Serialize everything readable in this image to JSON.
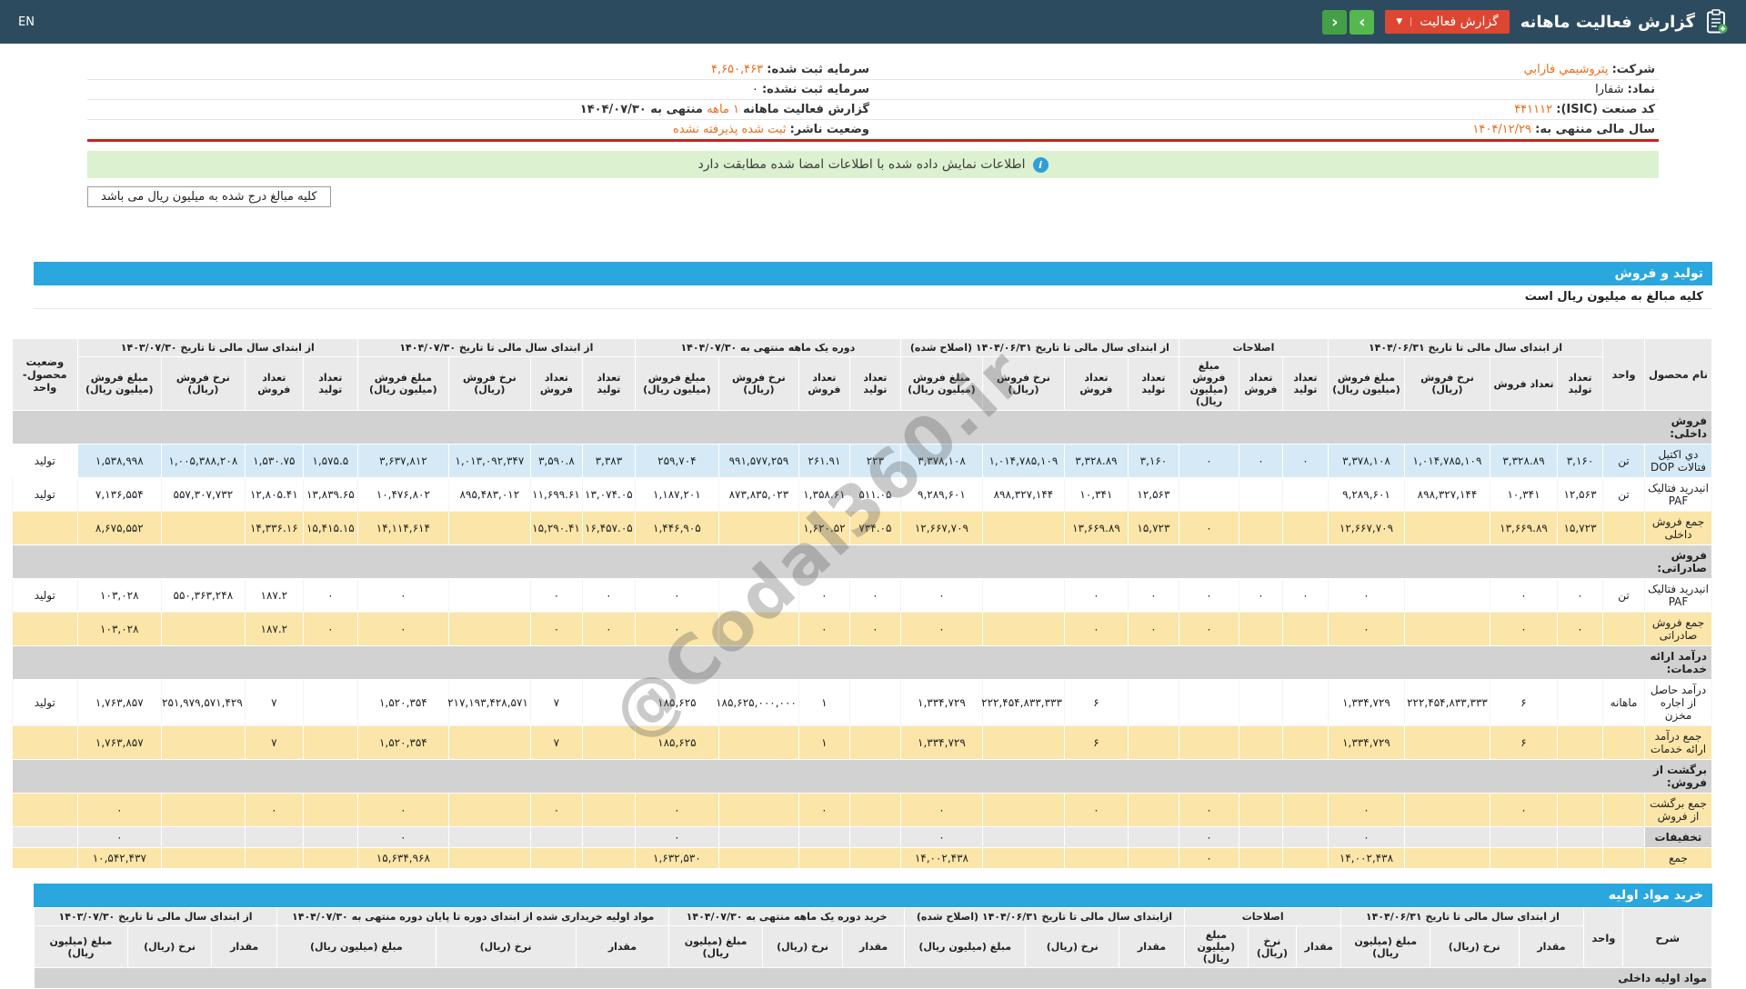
{
  "topbar": {
    "en_label": "EN",
    "title": "گزارش فعالیت ماهانه",
    "report_button_label": "گزارش فعالیت",
    "caret": "▼",
    "nav_right_icon": "›",
    "nav_left_icon": "‹"
  },
  "company_info": {
    "rows": [
      {
        "right_label": "شرکت:",
        "right_value": "پتروشيمي فارابي",
        "right_orange": true,
        "left_label": "سرمایه ثبت شده:",
        "left_value": "۴,۶۵۰,۴۶۳",
        "left_orange": true
      },
      {
        "right_label": "نماد:",
        "right_value": "شفارا",
        "right_orange": false,
        "left_label": "سرمایه ثبت نشده:",
        "left_value": "۰",
        "left_orange": false
      },
      {
        "right_label": "کد صنعت (ISIC):",
        "right_value": "۴۴۱۱۱۲",
        "right_orange": true,
        "left_label": "گزارش فعالیت ماهانه",
        "left_value": "۱ ماهه",
        "left_orange": true,
        "left_suffix": "منتهی به ۱۴۰۴/۰۷/۳۰"
      },
      {
        "right_label": "سال مالی منتهی به:",
        "right_value": "۱۴۰۴/۱۲/۲۹",
        "right_orange": true,
        "left_label": "وضعیت ناشر:",
        "left_value": "ثبت شده پذیرفته نشده",
        "left_orange": true
      }
    ]
  },
  "notice": {
    "icon": "i",
    "text": "اطلاعات نمایش داده شده با اطلاعات امضا شده مطابقت دارد"
  },
  "amounts_note": "کلیه مبالغ درج شده به میلیون ریال می باشد",
  "watermark": "@Codal360.ir",
  "sales_table": {
    "section_title": "تولید و فروش",
    "subtitle": "کلیه مبالغ به میلیون ریال است",
    "col_name": "نام محصول",
    "col_unit": "واحد",
    "corner": "وضعیت محصول- واحد",
    "groups": [
      {
        "title": "از ابتدای سال مالی تا تاریخ ۱۴۰۴/۰۶/۳۱",
        "cols": [
          "تعداد تولید",
          "تعداد فروش",
          "نرخ فروش (ریال)",
          "مبلغ فروش (میلیون ریال)"
        ]
      },
      {
        "title": "اصلاحات",
        "cols": [
          "تعداد تولید",
          "تعداد فروش",
          "مبلغ فروش (میلیون ریال)"
        ]
      },
      {
        "title": "از ابتدای سال مالی تا تاریخ ۱۴۰۴/۰۶/۳۱ (اصلاح شده)",
        "cols": [
          "تعداد تولید",
          "تعداد فروش",
          "نرخ فروش (ریال)",
          "مبلغ فروش (میلیون ریال)"
        ]
      },
      {
        "title": "دوره یک ماهه منتهی به ۱۴۰۴/۰۷/۳۰",
        "cols": [
          "تعداد تولید",
          "تعداد فروش",
          "نرخ فروش (ریال)",
          "مبلغ فروش (میلیون ریال)"
        ]
      },
      {
        "title": "از ابتدای سال مالی تا تاریخ ۱۴۰۴/۰۷/۳۰",
        "cols": [
          "تعداد تولید",
          "تعداد فروش",
          "نرخ فروش (ریال)",
          "مبلغ فروش (میلیون ریال)"
        ]
      },
      {
        "title": "از ابتدای سال مالی تا تاریخ ۱۴۰۳/۰۷/۳۰",
        "cols": [
          "تعداد تولید",
          "تعداد فروش",
          "نرخ فروش (ریال)",
          "مبلغ فروش (میلیون ریال)"
        ]
      }
    ],
    "rows": [
      {
        "type": "section",
        "label": "فروش داخلی:"
      },
      {
        "type": "data",
        "style": "blue",
        "name": "دي اکتيل فتالات DOP",
        "unit": "تن",
        "status": "تولید",
        "cells": [
          "۳,۱۶۰",
          "۳,۳۲۸.۸۹",
          "۱,۰۱۴,۷۸۵,۱۰۹",
          "۳,۳۷۸,۱۰۸",
          "۰",
          "۰",
          "۰",
          "۳,۱۶۰",
          "۳,۳۲۸.۸۹",
          "۱,۰۱۴,۷۸۵,۱۰۹",
          "۳,۳۷۸,۱۰۸",
          "۲۲۳",
          "۲۶۱.۹۱",
          "۹۹۱,۵۷۷,۲۵۹",
          "۲۵۹,۷۰۴",
          "۳,۳۸۳",
          "۳,۵۹۰.۸",
          "۱,۰۱۳,۰۹۲,۳۴۷",
          "۳,۶۳۷,۸۱۲",
          "۱,۵۷۵.۵",
          "۱,۵۳۰.۷۵",
          "۱,۰۰۵,۳۸۸,۲۰۸",
          "۱,۵۳۸,۹۹۸"
        ]
      },
      {
        "type": "data",
        "style": "white",
        "name": "انیدرید فتالیک PAF",
        "unit": "تن",
        "status": "تولید",
        "cells": [
          "۱۲,۵۶۳",
          "۱۰,۳۴۱",
          "۸۹۸,۳۲۷,۱۴۴",
          "۹,۲۸۹,۶۰۱",
          "",
          "",
          "",
          "۱۲,۵۶۳",
          "۱۰,۳۴۱",
          "۸۹۸,۳۲۷,۱۴۴",
          "۹,۲۸۹,۶۰۱",
          "۵۱۱.۰۵",
          "۱,۳۵۸.۶۱",
          "۸۷۳,۸۳۵,۰۲۳",
          "۱,۱۸۷,۲۰۱",
          "۱۳,۰۷۴.۰۵",
          "۱۱,۶۹۹.۶۱",
          "۸۹۵,۴۸۳,۰۱۲",
          "۱۰,۴۷۶,۸۰۲",
          "۱۳,۸۳۹.۶۵",
          "۱۲,۸۰۵.۴۱",
          "۵۵۷,۳۰۷,۷۳۲",
          "۷,۱۳۶,۵۵۴"
        ]
      },
      {
        "type": "data",
        "style": "orange",
        "name": "جمع فروش داخلی",
        "unit": "",
        "status": "",
        "cells": [
          "۱۵,۷۲۳",
          "۱۳,۶۶۹.۸۹",
          "",
          "۱۲,۶۶۷,۷۰۹",
          "",
          "",
          "۰",
          "۱۵,۷۲۳",
          "۱۳,۶۶۹.۸۹",
          "",
          "۱۲,۶۶۷,۷۰۹",
          "۷۳۴.۰۵",
          "۱,۶۲۰.۵۲",
          "",
          "۱,۴۴۶,۹۰۵",
          "۱۶,۴۵۷.۰۵",
          "۱۵,۲۹۰.۴۱",
          "",
          "۱۴,۱۱۴,۶۱۴",
          "۱۵,۴۱۵.۱۵",
          "۱۴,۳۳۶.۱۶",
          "",
          "۸,۶۷۵,۵۵۲"
        ]
      },
      {
        "type": "section",
        "label": "فروش صادراتی:"
      },
      {
        "type": "data",
        "style": "white",
        "name": "انیدرید فتالیک PAF",
        "unit": "تن",
        "status": "تولید",
        "cells": [
          "۰",
          "۰",
          "",
          "۰",
          "۰",
          "۰",
          "۰",
          "۰",
          "۰",
          "",
          "۰",
          "۰",
          "۰",
          "",
          "۰",
          "۰",
          "۰",
          "",
          "۰",
          "۰",
          "۱۸۷.۲",
          "۵۵۰,۳۶۳,۲۴۸",
          "۱۰۳,۰۲۸"
        ]
      },
      {
        "type": "data",
        "style": "orange",
        "name": "جمع فروش صادراتی",
        "unit": "",
        "status": "",
        "cells": [
          "۰",
          "۰",
          "",
          "۰",
          "",
          "",
          "۰",
          "۰",
          "۰",
          "",
          "۰",
          "۰",
          "۰",
          "",
          "۰",
          "۰",
          "۰",
          "",
          "۰",
          "۰",
          "۱۸۷.۲",
          "",
          "۱۰۳,۰۲۸"
        ]
      },
      {
        "type": "section",
        "label": "درآمد ارائه خدمات:"
      },
      {
        "type": "data",
        "style": "white",
        "name": "درآمد حاصل از اجاره مخزن",
        "unit": "ماهانه",
        "status": "تولید",
        "cells": [
          "",
          "۶",
          "۲۲۲,۴۵۴,۸۳۳,۳۳۳",
          "۱,۳۳۴,۷۲۹",
          "",
          "",
          "",
          "",
          "۶",
          "۲۲۲,۴۵۴,۸۳۳,۳۳۳",
          "۱,۳۳۴,۷۲۹",
          "",
          "۱",
          "۱۸۵,۶۲۵,۰۰۰,۰۰۰",
          "۱۸۵,۶۲۵",
          "",
          "۷",
          "۲۱۷,۱۹۳,۴۲۸,۵۷۱",
          "۱,۵۲۰,۳۵۴",
          "",
          "۷",
          "۲۵۱,۹۷۹,۵۷۱,۴۲۹",
          "۱,۷۶۳,۸۵۷"
        ]
      },
      {
        "type": "data",
        "style": "orange",
        "name": "جمع درآمد ارائه خدمات",
        "unit": "",
        "status": "",
        "cells": [
          "",
          "۶",
          "",
          "۱,۳۳۴,۷۲۹",
          "",
          "",
          "",
          "",
          "۶",
          "",
          "۱,۳۳۴,۷۲۹",
          "",
          "۱",
          "",
          "۱۸۵,۶۲۵",
          "",
          "۷",
          "",
          "۱,۵۲۰,۳۵۴",
          "",
          "۷",
          "",
          "۱,۷۶۳,۸۵۷"
        ]
      },
      {
        "type": "section",
        "label": "برگشت از فروش:"
      },
      {
        "type": "data",
        "style": "orange",
        "name": "جمع برگشت از فروش",
        "unit": "",
        "status": "",
        "cells": [
          "",
          "۰",
          "",
          "۰",
          "",
          "",
          "۰",
          "",
          "۰",
          "",
          "۰",
          "",
          "۰",
          "",
          "۰",
          "",
          "۰",
          "",
          "۰",
          "",
          "۰",
          "",
          "۰"
        ]
      },
      {
        "type": "data",
        "style": "gray",
        "name": "تخفیفات",
        "unit": "",
        "status": "",
        "cells": [
          "",
          "",
          "",
          "۰",
          "",
          "",
          "۰",
          "",
          "",
          "",
          "۰",
          "",
          "",
          "",
          "۰",
          "",
          "",
          "",
          "۰",
          "",
          "",
          "",
          "۰"
        ]
      },
      {
        "type": "data",
        "style": "orange",
        "name": "جمع",
        "unit": "",
        "status": "",
        "cells": [
          "",
          "",
          "",
          "۱۴,۰۰۲,۴۳۸",
          "",
          "",
          "۰",
          "",
          "",
          "",
          "۱۴,۰۰۲,۴۳۸",
          "",
          "",
          "",
          "۱,۶۳۲,۵۳۰",
          "",
          "",
          "",
          "۱۵,۶۳۴,۹۶۸",
          "",
          "",
          "",
          "۱۰,۵۴۲,۴۳۷"
        ]
      }
    ]
  },
  "materials_table": {
    "section_title": "خرید مواد اولیه",
    "col_name": "شرح",
    "col_unit": "واحد",
    "groups": [
      {
        "title": "از ابتدای سال مالی تا تاریخ ۱۴۰۴/۰۶/۳۱",
        "cols": [
          "مقدار",
          "نرخ (ریال)",
          "مبلغ (میلیون ریال)"
        ]
      },
      {
        "title": "اصلاحات",
        "cols": [
          "مقدار",
          "نرخ (ریال)",
          "مبلغ (میلیون ریال)"
        ]
      },
      {
        "title": "ازابتدای سال مالی تا تاریخ ۱۴۰۴/۰۶/۳۱ (اصلاح شده)",
        "cols": [
          "مقدار",
          "نرخ (ریال)",
          "مبلغ (میلیون ریال)"
        ]
      },
      {
        "title": "خرید دوره یک ماهه منتهی به ۱۴۰۴/۰۷/۳۰",
        "cols": [
          "مقدار",
          "نرخ (ریال)",
          "مبلغ (میلیون ریال)"
        ]
      },
      {
        "title": "مواد اولیه خریداری شده از ابتدای دوره تا پایان دوره منتهی به ۱۴۰۴/۰۷/۳۰",
        "cols": [
          "مقدار",
          "نرخ (ریال)",
          "مبلغ (میلیون ریال)"
        ]
      },
      {
        "title": "از ابتدای سال مالی تا تاریخ ۱۴۰۳/۰۷/۳۰",
        "cols": [
          "مقدار",
          "نرخ (ریال)",
          "مبلغ (میلیون ریال)"
        ]
      }
    ],
    "rows": [
      {
        "type": "section",
        "label": "مواد اولیه داخلی"
      }
    ]
  }
}
